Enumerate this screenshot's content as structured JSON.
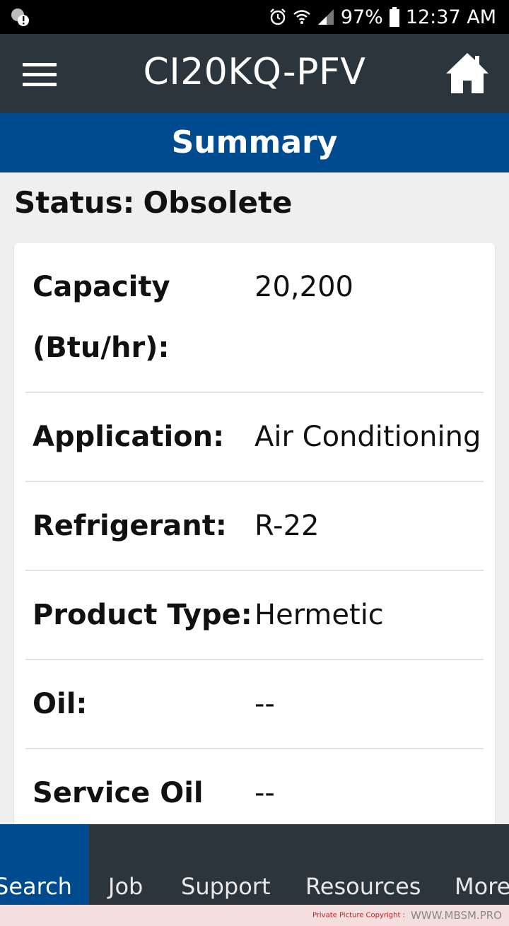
{
  "status_bar": {
    "battery": "97%",
    "time": "12:37 AM",
    "icons": [
      "notification-icon",
      "alarm-icon",
      "wifi-icon",
      "signal-icon",
      "battery-icon"
    ]
  },
  "app_bar": {
    "title": "CI20KQ-PFV",
    "icons": [
      "menu-icon",
      "home-icon"
    ]
  },
  "banner": {
    "label": "Summary"
  },
  "status": {
    "label": "Status:",
    "value": "Obsolete"
  },
  "specs": [
    {
      "label": "Capacity (Btu/hr):",
      "value": "20,200"
    },
    {
      "label": "Application:",
      "value": "Air Conditioning"
    },
    {
      "label": "Refrigerant:",
      "value": "R-22"
    },
    {
      "label": "Product Type:",
      "value": "Hermetic"
    },
    {
      "label": "Oil:",
      "value": "--"
    },
    {
      "label": "Service Oil",
      "value": "--"
    }
  ],
  "bottom_nav": {
    "tabs": [
      {
        "label": "Search",
        "active": true
      },
      {
        "label": "Job",
        "active": false
      },
      {
        "label": "Support",
        "active": false
      },
      {
        "label": "Resources",
        "active": false
      },
      {
        "label": "More",
        "active": false
      }
    ]
  },
  "watermark": {
    "copyright": "Private Picture Copyright :",
    "site": "WWW.MBSM.PRO"
  },
  "colors": {
    "app_bar": "#2c353c",
    "accent": "#004b8f",
    "background": "#efefef"
  }
}
